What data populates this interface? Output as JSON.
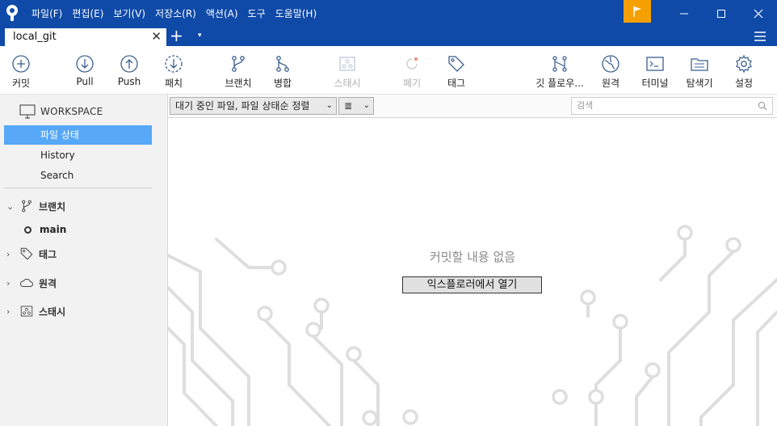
{
  "menu": [
    "파일(F)",
    "편집(E)",
    "보기(V)",
    "저장소(R)",
    "액션(A)",
    "도구",
    "도움말(H)"
  ],
  "tab": {
    "label": "local_git",
    "close": "✕",
    "add": "+",
    "dropdown": "▾"
  },
  "toolbar": {
    "commit": "커밋",
    "pull": "Pull",
    "push": "Push",
    "fetch": "패치",
    "branch": "브랜치",
    "merge": "병합",
    "stash": "스태시",
    "discard": "폐기",
    "tag": "태그",
    "git_flow": "깃 플로우...",
    "remote": "원격",
    "terminal": "터미널",
    "explorer": "탐색기",
    "settings": "설정"
  },
  "sidebar": {
    "workspace": "WORKSPACE",
    "file_status": "파일 상태",
    "history": "History",
    "search": "Search",
    "branches": "브랜치",
    "current_branch": "main",
    "tags": "태그",
    "remotes": "원격",
    "stashes": "스태시"
  },
  "filter": {
    "pending_sort": "대기 중인 파일, 파일 상태순 정렬",
    "view_glyph": "≣",
    "search_placeholder": "검색"
  },
  "main": {
    "empty_message": "커밋할 내용 없음",
    "open_explorer": "익스플로러에서 열기"
  },
  "colors": {
    "title_bar": "#0f4aa8",
    "selected": "#57a8f7",
    "flag": "#f5a000",
    "icon": "#3a5f8f"
  }
}
